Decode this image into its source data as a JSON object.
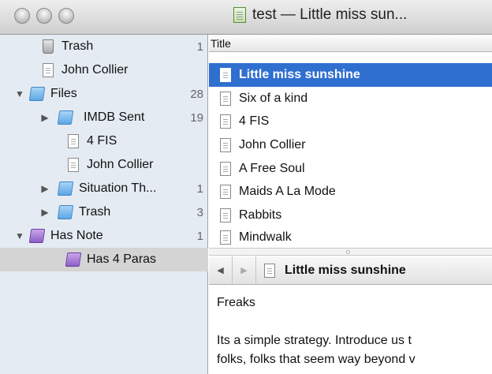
{
  "window": {
    "title": "test — Little miss sun..."
  },
  "sidebar": {
    "items": [
      {
        "label": "Trash",
        "count": "1",
        "icon": "trash-icon"
      },
      {
        "label": "John Collier",
        "count": "",
        "icon": "document-icon"
      },
      {
        "label": "Files",
        "count": "28",
        "icon": "folder-icon",
        "disclosure": "expanded"
      },
      {
        "label": "IMDB Sent",
        "count": "19",
        "icon": "folder-icon",
        "disclosure": "collapsed"
      },
      {
        "label": "4 FIS",
        "count": "",
        "icon": "document-icon"
      },
      {
        "label": "John Collier",
        "count": "",
        "icon": "document-icon"
      },
      {
        "label": "Situation Th...",
        "count": "1",
        "icon": "folder-icon",
        "disclosure": "collapsed"
      },
      {
        "label": "Trash",
        "count": "3",
        "icon": "folder-icon",
        "disclosure": "collapsed"
      },
      {
        "label": "Has Note",
        "count": "1",
        "icon": "smart-folder-icon",
        "disclosure": "expanded"
      },
      {
        "label": "Has 4 Paras",
        "count": "",
        "icon": "smart-folder-icon",
        "selected": true
      }
    ]
  },
  "notes_list": {
    "column_header": "Title",
    "items": [
      {
        "title": "Little miss sunshine",
        "selected": true
      },
      {
        "title": "Six of a kind"
      },
      {
        "title": "4 FIS"
      },
      {
        "title": "John Collier"
      },
      {
        "title": "A Free Soul"
      },
      {
        "title": "Maids A La Mode"
      },
      {
        "title": "Rabbits"
      },
      {
        "title": "Mindwalk"
      }
    ]
  },
  "navbar": {
    "back": "◀",
    "forward": "▶",
    "current_title": "Little miss sunshine"
  },
  "note_content": {
    "line1": "Freaks",
    "line2": "Its a simple strategy. Introduce us t",
    "line3": "folks, folks that seem way beyond v"
  },
  "colors": {
    "selection": "#2f6fd0",
    "sidebar_bg": "#e5ebf3",
    "sidebar_selected": "#d4d4d4"
  }
}
